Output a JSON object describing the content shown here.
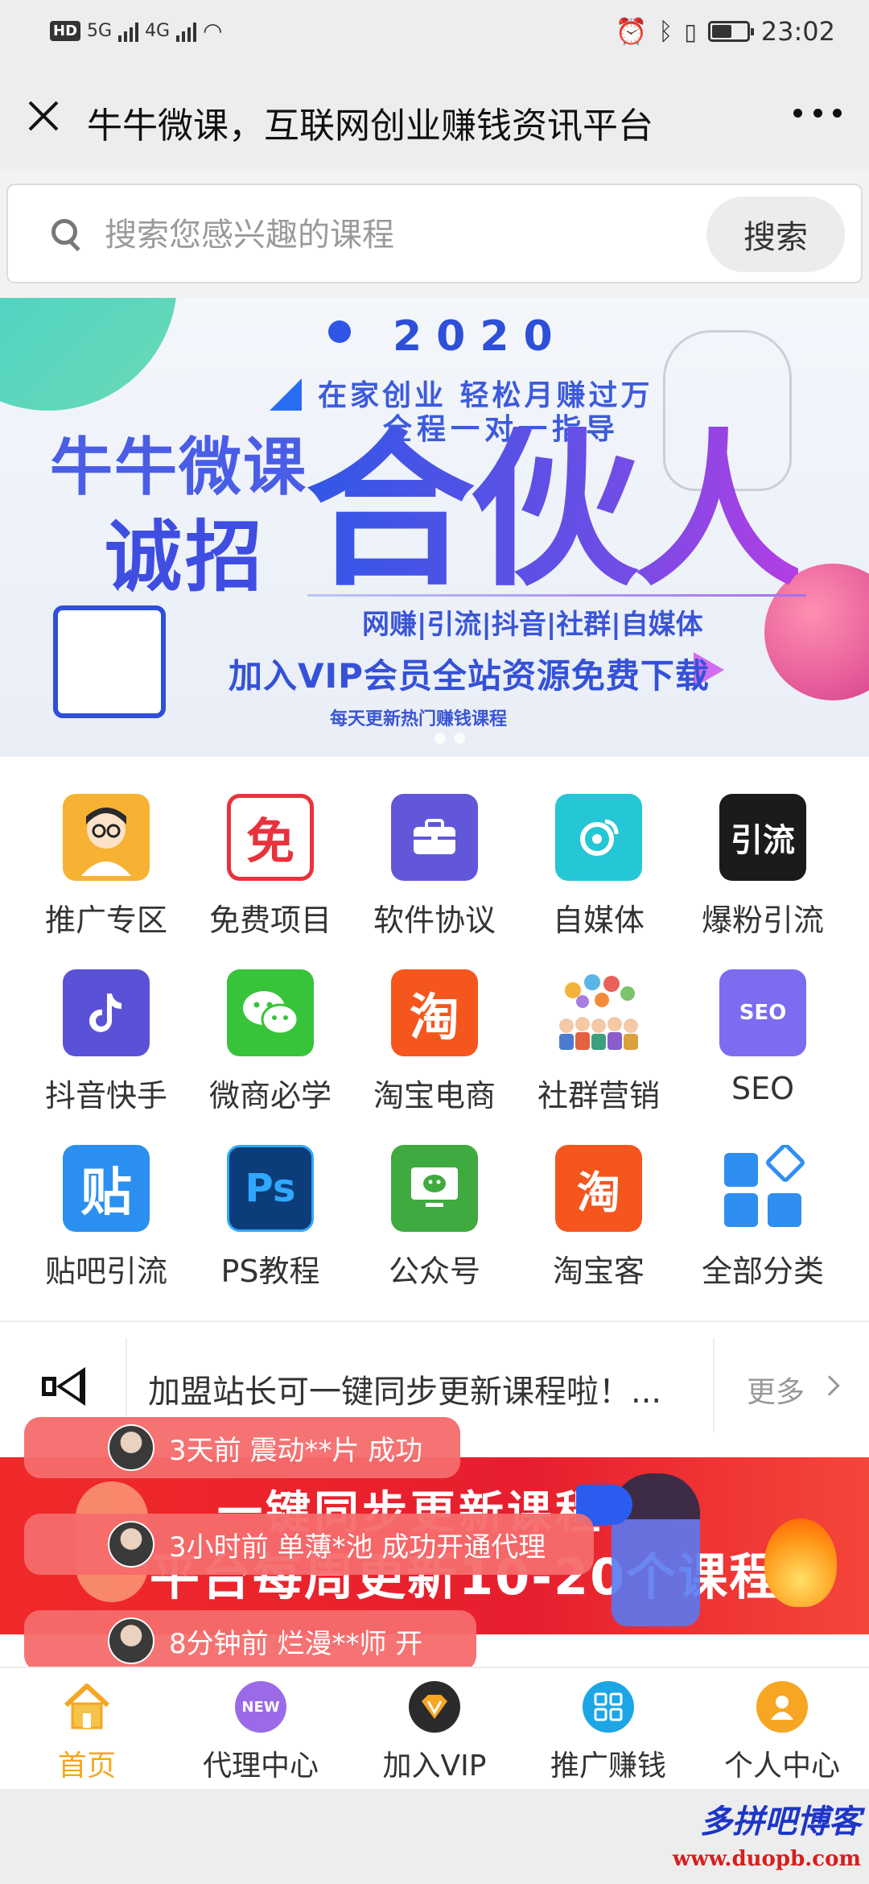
{
  "status_bar": {
    "network_hd": "HD",
    "network_5g": "5G",
    "network_4g": "4G",
    "time": "23:02",
    "icons": [
      "alarm-icon",
      "bluetooth-icon",
      "vibrate-icon",
      "battery-icon"
    ]
  },
  "titlebar": {
    "title": "牛牛微课，互联网创业赚钱资讯平台"
  },
  "search": {
    "placeholder": "搜索您感兴趣的课程",
    "button": "搜索"
  },
  "banner": {
    "year": "2020",
    "line1": "在家创业 轻松月赚过万",
    "line2": "全程一对一指导",
    "brand": "牛牛微课",
    "recruit": "诚招",
    "headline": "合伙人",
    "categories": "网赚|引流|抖音|社群|自媒体",
    "join": "加入VIP会员全站资源免费下载",
    "daily": "每天更新热门赚钱课程"
  },
  "categories": [
    {
      "label": "推广专区",
      "icon": "avatar-icon",
      "color": "#f7b233"
    },
    {
      "label": "免费项目",
      "icon": "free-icon",
      "color": "#e8323c",
      "glyph": "免"
    },
    {
      "label": "软件协议",
      "icon": "briefcase-icon",
      "color": "#6257d8"
    },
    {
      "label": "自媒体",
      "icon": "media-icon",
      "color": "#25c6d6"
    },
    {
      "label": "爆粉引流",
      "icon": "traffic-icon",
      "color": "#1b1b1b",
      "glyph": "引流"
    },
    {
      "label": "抖音快手",
      "icon": "tiktok-icon",
      "color": "#5a52d6"
    },
    {
      "label": "微商必学",
      "icon": "wechat-icon",
      "color": "#37c43a"
    },
    {
      "label": "淘宝电商",
      "icon": "taobao-icon",
      "color": "#f5561d",
      "glyph": "淘"
    },
    {
      "label": "社群营销",
      "icon": "community-icon",
      "color": "#7aa6d8"
    },
    {
      "label": "SEO",
      "icon": "seo-icon",
      "color": "#7b6cf0",
      "glyph": "SEO"
    },
    {
      "label": "贴吧引流",
      "icon": "tieba-icon",
      "color": "#2b8ff0",
      "glyph": "贴"
    },
    {
      "label": "PS教程",
      "icon": "photoshop-icon",
      "color": "#0c3d7a",
      "glyph": "Ps"
    },
    {
      "label": "公众号",
      "icon": "official-account-icon",
      "color": "#3eaa3f"
    },
    {
      "label": "淘宝客",
      "icon": "taobaoke-icon",
      "color": "#f5561d",
      "glyph": "淘"
    },
    {
      "label": "全部分类",
      "icon": "all-categories-icon",
      "color": "#2f8ff0"
    }
  ],
  "notice": {
    "text": "加盟站长可一键同步更新课程啦！...",
    "more": "更多"
  },
  "promo": {
    "line1": "一键同步更新课程",
    "line2": "平台每周更新10-20个课程"
  },
  "toasts": [
    {
      "text": "3天前 震动**片 成功"
    },
    {
      "text": "3小时前 单薄*池 成功开通代理"
    },
    {
      "text": "8分钟前 烂漫**师 开"
    }
  ],
  "tabs": [
    {
      "label": "首页",
      "icon": "home-icon",
      "active": true
    },
    {
      "label": "代理中心",
      "icon": "new-icon",
      "badge": "NEW"
    },
    {
      "label": "加入VIP",
      "icon": "vip-icon"
    },
    {
      "label": "推广赚钱",
      "icon": "grid-icon"
    },
    {
      "label": "个人中心",
      "icon": "user-icon"
    }
  ],
  "watermark": {
    "line1": "多拼吧博客",
    "line2": "www.duopb.com"
  },
  "colors": {
    "accent": "#f6a623",
    "toast": "#f66c6c",
    "promo": "#e61e2e",
    "banner_blue": "#3f4ee0"
  }
}
